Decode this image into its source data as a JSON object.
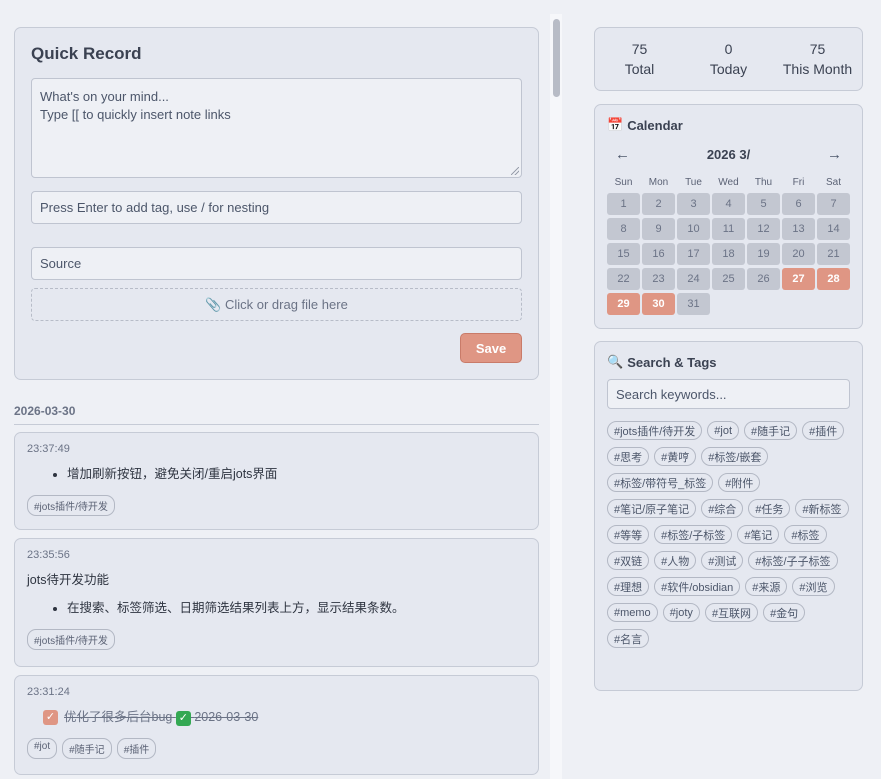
{
  "quick_record": {
    "title": "Quick Record",
    "content_placeholder_line1": "What's on your mind...",
    "content_placeholder_line2": "Type [[ to quickly insert note links",
    "tag_placeholder": "Press Enter to add tag, use / for nesting",
    "source_placeholder": "Source",
    "dropzone_label": "📎 Click or drag file here",
    "save_label": "Save"
  },
  "notes_date": "2026-03-30",
  "notes": [
    {
      "time": "23:37:49",
      "bullet": "增加刷新按钮，避免关闭/重启jots界面",
      "tags": [
        "#jots插件/待开发"
      ]
    },
    {
      "time": "23:35:56",
      "heading": "jots待开发功能",
      "bullet": "在搜索、标签筛选、日期筛选结果列表上方，显示结果条数。",
      "tags": [
        "#jots插件/待开发"
      ]
    },
    {
      "time": "23:31:24",
      "task": "优化了很多后台bug",
      "task_date": "2026-03-30",
      "tags": [
        "#jot",
        "#随手记",
        "#插件"
      ]
    }
  ],
  "stats": [
    {
      "value": "75",
      "label": "Total"
    },
    {
      "value": "0",
      "label": "Today"
    },
    {
      "value": "75",
      "label": "This Month"
    }
  ],
  "calendar": {
    "title": "Calendar",
    "month": "2026 3/",
    "prev": "←",
    "next": "→",
    "weekdays": [
      "Sun",
      "Mon",
      "Tue",
      "Wed",
      "Thu",
      "Fri",
      "Sat"
    ],
    "days": [
      "1",
      "2",
      "3",
      "4",
      "5",
      "6",
      "7",
      "8",
      "9",
      "10",
      "11",
      "12",
      "13",
      "14",
      "15",
      "16",
      "17",
      "18",
      "19",
      "20",
      "21",
      "22",
      "23",
      "24",
      "25",
      "26",
      "27",
      "28",
      "29",
      "30",
      "31"
    ],
    "highlighted": [
      "27",
      "28",
      "29",
      "30"
    ]
  },
  "search": {
    "title": "Search & Tags",
    "placeholder": "Search keywords...",
    "tags": [
      "#jots插件/待开发",
      "#jot",
      "#随手记",
      "#插件",
      "#思考",
      "#黄哼",
      "#标签/嵌套",
      "#标签/带符号_标签",
      "#附件",
      "#笔记/原子笔记",
      "#综合",
      "#任务",
      "#新标签",
      "#等等",
      "#标签/子标签",
      "#笔记",
      "#标签",
      "#双链",
      "#人物",
      "#测试",
      "#标签/子子标签",
      "#理想",
      "#软件/obsidian",
      "#来源",
      "#浏览",
      "#memo",
      "#joty",
      "#互联网",
      "#金句",
      "#名言"
    ]
  },
  "colors": {
    "accent": "#df9684",
    "card": "#e5e8f0",
    "background": "#eef0f5"
  }
}
